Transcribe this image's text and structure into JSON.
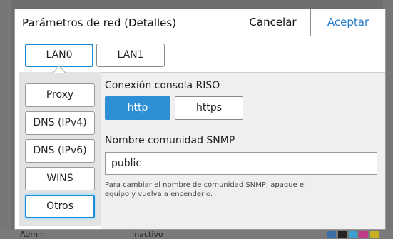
{
  "background": {
    "user_label": "Admin",
    "status_label": "Inactivo"
  },
  "dialog": {
    "title": "Parámetros de red (Detalles)",
    "cancel_label": "Cancelar",
    "accept_label": "Aceptar"
  },
  "tabs": [
    {
      "label": "LAN0",
      "selected": true
    },
    {
      "label": "LAN1",
      "selected": false
    }
  ],
  "sidebar": {
    "items": [
      {
        "label": "Proxy",
        "selected": false
      },
      {
        "label": "DNS (IPv4)",
        "selected": false
      },
      {
        "label": "DNS (IPv6)",
        "selected": false
      },
      {
        "label": "WINS",
        "selected": false
      },
      {
        "label": "Otros",
        "selected": true
      }
    ]
  },
  "main": {
    "riso_console": {
      "label": "Conexión consola RISO",
      "options": [
        "http",
        "https"
      ],
      "selected": "http"
    },
    "snmp": {
      "label": "Nombre comunidad SNMP",
      "value": "public",
      "note": "Para cambiar el nombre de comunidad SNMP, apague el equipo y vuelva a encenderlo."
    }
  },
  "colors": {
    "accent": "#1f8ad6",
    "selected_segment": "#2d8fd6",
    "accept_text": "#1f78c8",
    "overlay": "#6e6e6e"
  }
}
